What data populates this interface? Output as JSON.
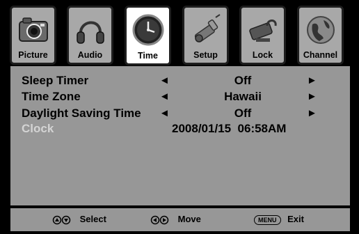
{
  "tabs": [
    {
      "label": "Picture",
      "icon": "camera-icon"
    },
    {
      "label": "Audio",
      "icon": "headphones-icon"
    },
    {
      "label": "Time",
      "icon": "clock-icon"
    },
    {
      "label": "Setup",
      "icon": "setup-icon"
    },
    {
      "label": "Lock",
      "icon": "lock-icon"
    },
    {
      "label": "Channel",
      "icon": "globe-icon"
    }
  ],
  "active_tab": "Time",
  "settings": [
    {
      "label": "Sleep Timer",
      "value": "Off"
    },
    {
      "label": "Time Zone",
      "value": "Hawaii"
    },
    {
      "label": "Daylight Saving Time",
      "value": "Off"
    },
    {
      "label": "Clock",
      "value": "2008/01/15  06:58AM"
    }
  ],
  "footer": {
    "select_label": "Select",
    "move_label": "Move",
    "menu_key": "MENU",
    "exit_label": "Exit"
  },
  "colors": {
    "panel": "#979797",
    "tab_inactive": "#a8a8a8",
    "tab_active": "#ffffff",
    "disabled_text": "#d4d4d4"
  }
}
